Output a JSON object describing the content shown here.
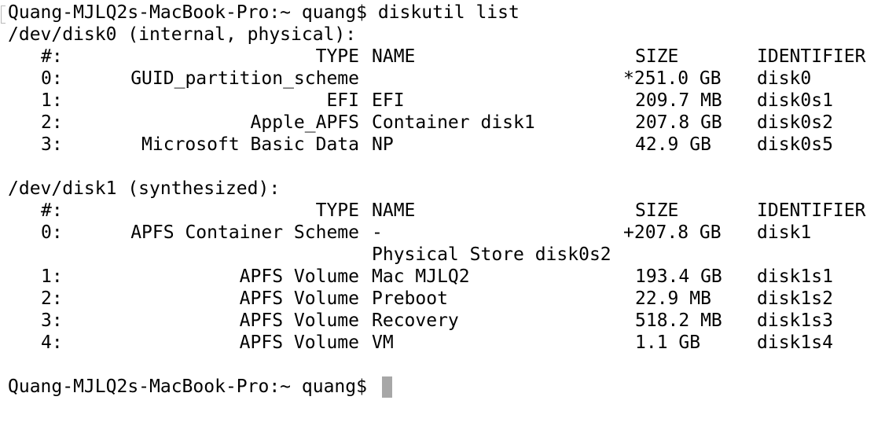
{
  "prompt": "Quang-MJLQ2s-MacBook-Pro:~ quang$",
  "command": "diskutil list",
  "disks": [
    {
      "header": "/dev/disk0 (internal, physical):",
      "columns": {
        "num": "#:",
        "type": "TYPE",
        "name": "NAME",
        "size": "SIZE",
        "identifier": "IDENTIFIER"
      },
      "rows": [
        {
          "num": "0:",
          "type": "GUID_partition_scheme",
          "name": "",
          "size": "*251.0 GB",
          "identifier": "disk0"
        },
        {
          "num": "1:",
          "type": "EFI",
          "name": "EFI",
          "size": "209.7 MB",
          "identifier": "disk0s1"
        },
        {
          "num": "2:",
          "type": "Apple_APFS",
          "name": "Container disk1",
          "size": "207.8 GB",
          "identifier": "disk0s2"
        },
        {
          "num": "3:",
          "type": "Microsoft Basic Data",
          "name": "NP",
          "size": "42.9 GB",
          "identifier": "disk0s5"
        }
      ]
    },
    {
      "header": "/dev/disk1 (synthesized):",
      "columns": {
        "num": "#:",
        "type": "TYPE",
        "name": "NAME",
        "size": "SIZE",
        "identifier": "IDENTIFIER"
      },
      "rows": [
        {
          "num": "0:",
          "type": "APFS Container Scheme",
          "name": "-",
          "size": "+207.8 GB",
          "identifier": "disk1"
        },
        {
          "num": "",
          "type": "",
          "name": "Physical Store disk0s2",
          "size": "",
          "identifier": ""
        },
        {
          "num": "1:",
          "type": "APFS Volume",
          "name": "Mac MJLQ2",
          "size": "193.4 GB",
          "identifier": "disk1s1"
        },
        {
          "num": "2:",
          "type": "APFS Volume",
          "name": "Preboot",
          "size": "22.9 MB",
          "identifier": "disk1s2"
        },
        {
          "num": "3:",
          "type": "APFS Volume",
          "name": "Recovery",
          "size": "518.2 MB",
          "identifier": "disk1s3"
        },
        {
          "num": "4:",
          "type": "APFS Volume",
          "name": "VM",
          "size": "1.1 GB",
          "identifier": "disk1s4"
        }
      ]
    }
  ],
  "cursor_icon": "block-cursor",
  "colors": {
    "background": "#ffffff",
    "text": "#000000",
    "cursor": "#a7a7a7"
  }
}
